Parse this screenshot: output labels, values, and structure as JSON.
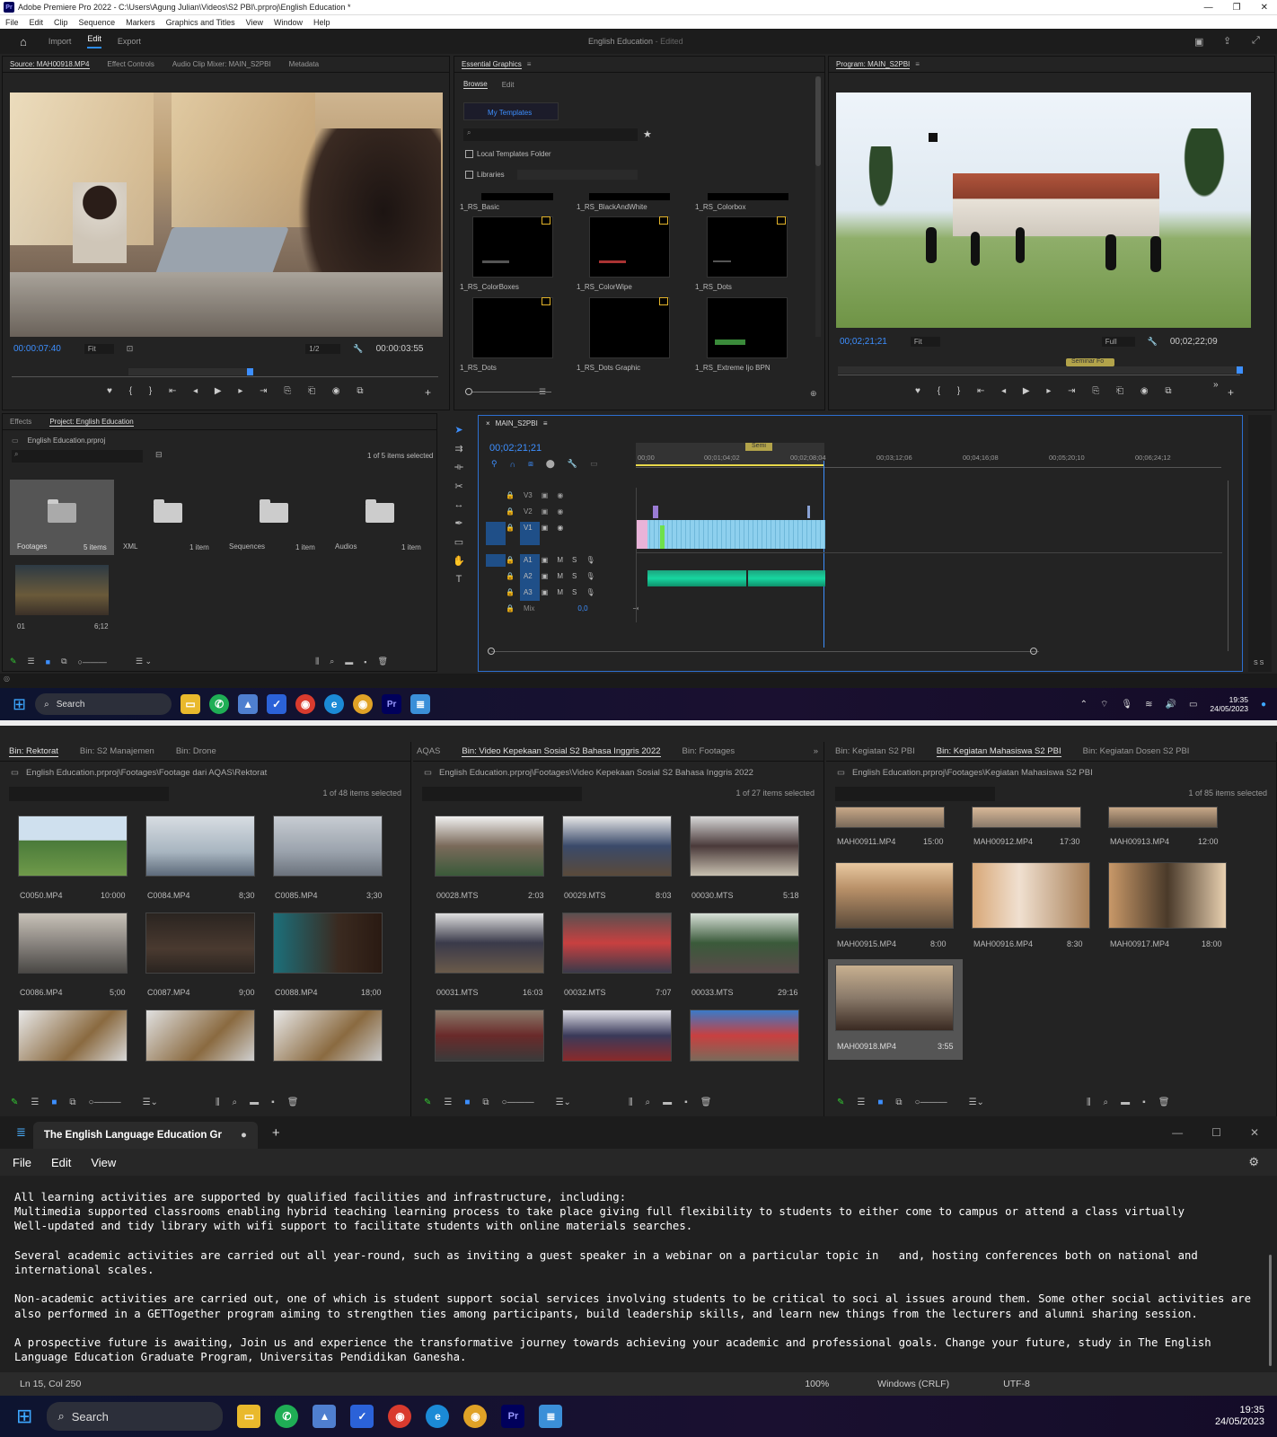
{
  "premiere": {
    "title": "Adobe Premiere Pro 2022 - C:\\Users\\Agung Julian\\Videos\\S2 PBI\\.prproj\\English Education *",
    "menu": [
      "File",
      "Edit",
      "Clip",
      "Sequence",
      "Markers",
      "Graphics and Titles",
      "View",
      "Window",
      "Help"
    ],
    "nav": {
      "home": "home-icon",
      "import": "Import",
      "edit": "Edit",
      "export": "Export",
      "project_title": "English Education",
      "project_status": "- Edited"
    },
    "source": {
      "tabs": [
        "Source: MAH00918.MP4",
        "Effect Controls",
        "Audio Clip Mixer: MAIN_S2PBI",
        "Metadata"
      ],
      "timecode": "00:00:07:40",
      "fit": "Fit",
      "resolution": "1/2",
      "duration": "00:00:03:55"
    },
    "essential_graphics": {
      "title": "Essential Graphics",
      "tabs": [
        "Browse",
        "Edit"
      ],
      "my_templates": "My Templates",
      "local_templates": "Local Templates Folder",
      "libraries": "Libraries",
      "templates": [
        "1_RS_Basic",
        "1_RS_BlackAndWhite",
        "1_RS_Colorbox",
        "1_RS_ColorBoxes",
        "1_RS_ColorWipe",
        "1_RS_Dots",
        "1_RS_Dots",
        "1_RS_Dots Graphic",
        "1_RS_Extreme Ijo BPN"
      ]
    },
    "program": {
      "title": "Program: MAIN_S2PBI",
      "timecode": "00;02;21;21",
      "fit": "Fit",
      "quality": "Full",
      "duration": "00;02;22;09",
      "marker_label": "Seminar Fo"
    },
    "project": {
      "tabs": [
        "Effects",
        "Project: English Education"
      ],
      "file": "English Education.prproj",
      "selected": "1 of 5 items selected",
      "items": [
        {
          "name": "Footages",
          "count": "5 items"
        },
        {
          "name": "XML",
          "count": "1 item"
        },
        {
          "name": "Sequences",
          "count": "1 item"
        },
        {
          "name": "Audios",
          "count": "1 item"
        }
      ],
      "clip": {
        "name": "01",
        "duration": "6;12"
      }
    },
    "timeline": {
      "sequence": "MAIN_S2PBI",
      "timecode": "00;02;21;21",
      "ruler": [
        "00;00",
        "00;01;04;02",
        "00;02;08;04",
        "00;03;12;06",
        "00;04;16;08",
        "00;05;20;10",
        "00;06;24;12"
      ],
      "marker": "Semi",
      "video_tracks": [
        "V3",
        "V2",
        "V1"
      ],
      "audio_tracks": [
        "A1",
        "A2",
        "A3"
      ],
      "mix_label": "Mix",
      "mix_value": "0,0",
      "meter_label": "S S"
    }
  },
  "taskbar_top": {
    "search": "Search",
    "time": "19:35",
    "date": "24/05/2023"
  },
  "bins": [
    {
      "tabs": [
        "Bin: Rektorat",
        "Bin: S2 Manajemen",
        "Bin: Drone"
      ],
      "path": "English Education.prproj\\Footages\\Footage dari AQAS\\Rektorat",
      "count": "1 of 48 items selected",
      "clips": [
        {
          "name": "C0050.MP4",
          "dur": "10:000"
        },
        {
          "name": "C0084.MP4",
          "dur": "8;30"
        },
        {
          "name": "C0085.MP4",
          "dur": "3;30"
        },
        {
          "name": "C0086.MP4",
          "dur": "5;00"
        },
        {
          "name": "C0087.MP4",
          "dur": "9;00"
        },
        {
          "name": "C0088.MP4",
          "dur": "18;00"
        }
      ]
    },
    {
      "tabs": [
        "AQAS",
        "Bin: Video Kepekaan Sosial S2 Bahasa Inggris 2022",
        "Bin: Footages"
      ],
      "path": "English Education.prproj\\Footages\\Video Kepekaan Sosial S2 Bahasa Inggris 2022",
      "count": "1 of 27 items selected",
      "clips": [
        {
          "name": "00028.MTS",
          "dur": "2:03"
        },
        {
          "name": "00029.MTS",
          "dur": "8:03"
        },
        {
          "name": "00030.MTS",
          "dur": "5:18"
        },
        {
          "name": "00031.MTS",
          "dur": "16:03"
        },
        {
          "name": "00032.MTS",
          "dur": "7:07"
        },
        {
          "name": "00033.MTS",
          "dur": "29:16"
        }
      ]
    },
    {
      "tabs": [
        "Bin: Kegiatan S2 PBI",
        "Bin: Kegiatan Mahasiswa S2 PBI",
        "Bin: Kegiatan Dosen S2 PBI"
      ],
      "path": "English Education.prproj\\Footages\\Kegiatan Mahasiswa S2 PBI",
      "count": "1 of 85 items selected",
      "clips": [
        {
          "name": "MAH00911.MP4",
          "dur": "15:00"
        },
        {
          "name": "MAH00912.MP4",
          "dur": "17:30"
        },
        {
          "name": "MAH00913.MP4",
          "dur": "12:00"
        },
        {
          "name": "MAH00915.MP4",
          "dur": "8:00"
        },
        {
          "name": "MAH00916.MP4",
          "dur": "8:30"
        },
        {
          "name": "MAH00917.MP4",
          "dur": "18:00"
        },
        {
          "name": "MAH00918.MP4",
          "dur": "3:55"
        }
      ]
    }
  ],
  "notepad": {
    "tab_title": "The English Language Education Gr",
    "menu": [
      "File",
      "Edit",
      "View"
    ],
    "content": "All learning activities are supported by qualified facilities and infrastructure, including:\nMultimedia supported classrooms enabling hybrid teaching learning process to take place giving full flexibility to students to either come to campus or attend a class virtually\nWell-updated and tidy library with wifi support to facilitate students with online materials searches.\n\nSeveral academic activities are carried out all year-round, such as inviting a guest speaker in a webinar on a particular topic in   and, hosting conferences both on national and\ninternational scales.\n\nNon-academic activities are carried out, one of which is student support social services involving students to be critical to soci al issues around them. Some other social activities are\nalso performed in a GETTogether program aiming to strengthen ties among participants, build leadership skills, and learn new things from the lecturers and alumni sharing session.\n\nA prospective future is awaiting, Join us and experience the transformative journey towards achieving your academic and professional goals. Change your future, study in The English\nLanguage Education Graduate Program, Universitas Pendidikan Ganesha.",
    "status": {
      "position": "Ln 15, Col 250",
      "zoom": "100%",
      "eol": "Windows (CRLF)",
      "encoding": "UTF-8"
    }
  },
  "taskbar_bottom": {
    "search": "Search",
    "time": "19:35",
    "date": "24/05/2023"
  }
}
